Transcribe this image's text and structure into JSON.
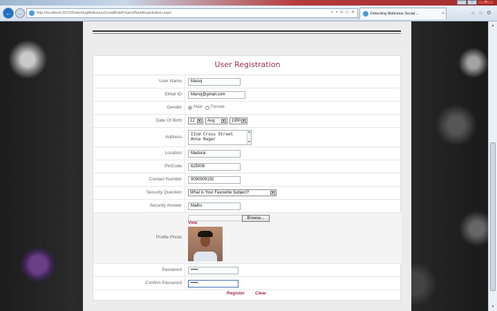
{
  "browser": {
    "url": "http://localhost:2072/DetectingMaliciousSocialBotsProject/NewRegistration.aspx",
    "url_host": "localhost",
    "address_tools": "⌕ ▾ ⊡ ↻ ✕",
    "tab_title": "Detecting Malicious Social ...",
    "tab_close": "×",
    "back": "←",
    "forward": "→",
    "window_buttons": {
      "minimize": "–",
      "maximize": "□",
      "close": "✕"
    },
    "toolbar_icons": {
      "home": "⌂",
      "favorites": "☆",
      "settings": "⚙"
    }
  },
  "form": {
    "title": "User Registration",
    "username": {
      "label": "User Name",
      "value": "Manoj"
    },
    "email": {
      "label": "EMail ID",
      "value": "Manoj@gmail.com"
    },
    "gender": {
      "label": "Gender",
      "options": [
        "Male",
        "Female"
      ],
      "selected": "Male"
    },
    "dob": {
      "label": "Date Of Birth",
      "day": "12",
      "month": "Aug",
      "year": "1990"
    },
    "address": {
      "label": "Address",
      "line1": "IInd Cross Street",
      "line2": "Anna Nagar"
    },
    "location": {
      "label": "Location",
      "value": "Madurai"
    },
    "pincode": {
      "label": "PinCode",
      "value": "625008"
    },
    "contact": {
      "label": "Contact Number",
      "value": "9090909192"
    },
    "security_question": {
      "label": "Security Question",
      "value": "What is Your Favourite Subject?"
    },
    "security_answer": {
      "label": "Security Answer",
      "value": "Maths"
    },
    "photo": {
      "label": "Profile Photo",
      "browse": "Browse...",
      "view": "View"
    },
    "password": {
      "label": "Password",
      "value": "•••••"
    },
    "confirm_password": {
      "label": "Confirm Password",
      "value": "•••••"
    },
    "register": "Register",
    "clear": "Clear"
  },
  "colors": {
    "accent": "#9b2d4e",
    "focus_border": "#3d6fb5"
  }
}
